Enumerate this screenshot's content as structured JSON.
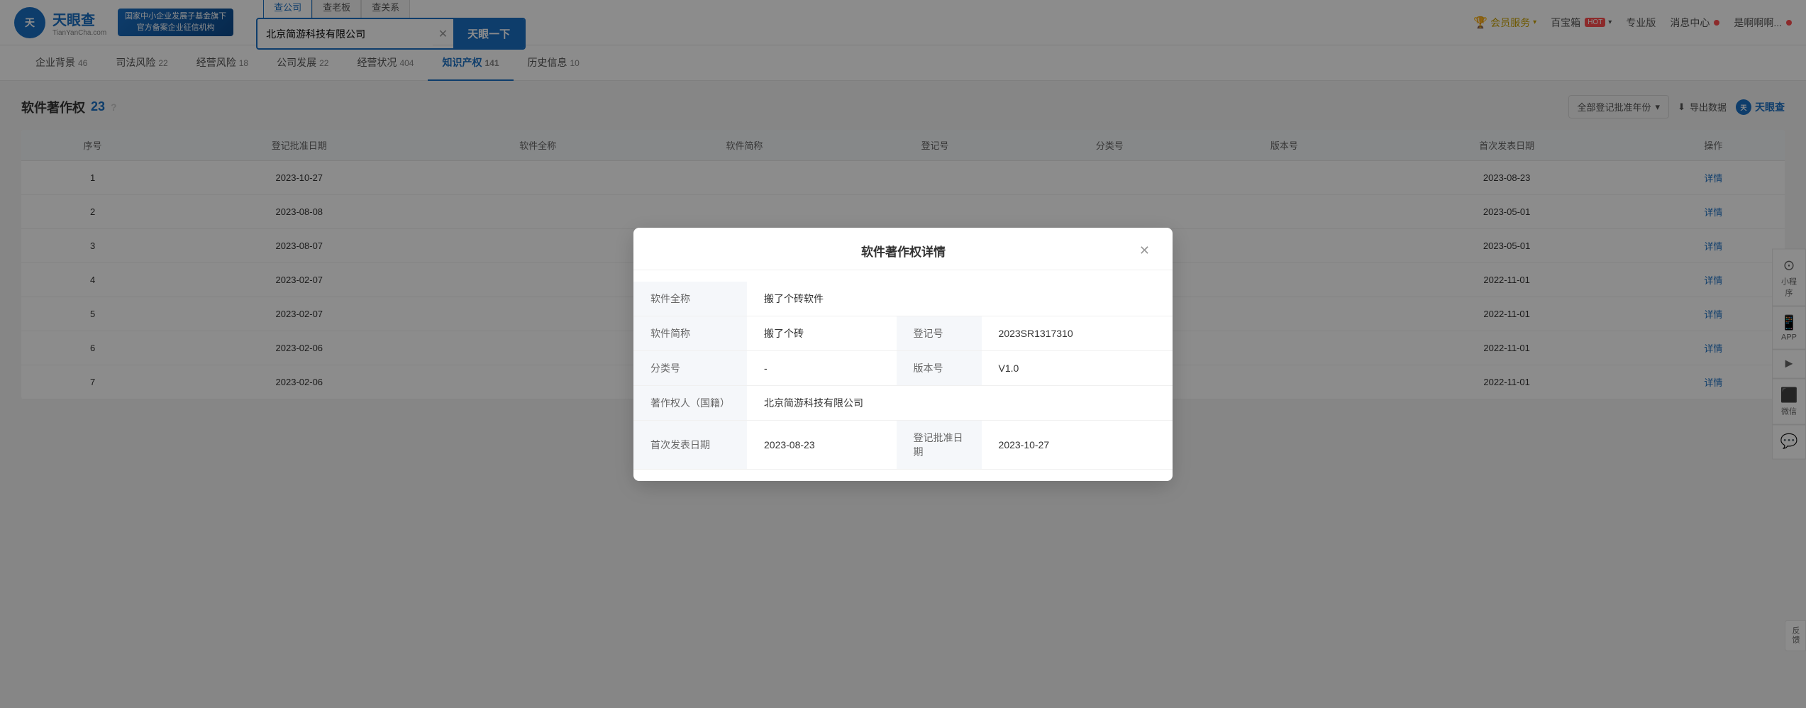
{
  "header": {
    "logo_main": "天眼查",
    "logo_sub": "TianYanCha.com",
    "gov_badge_line1": "国家中小企业发展子基金旗下",
    "gov_badge_line2": "官方备案企业征信机构",
    "search_tabs": [
      "查公司",
      "查老板",
      "查关系"
    ],
    "search_value": "北京简游科技有限公司",
    "search_btn": "天眼一下",
    "nav_items": [
      {
        "label": "会员服务",
        "type": "vip"
      },
      {
        "label": "百宝箱",
        "hot": true
      },
      {
        "label": "专业版"
      },
      {
        "label": "消息中心",
        "dot": true
      },
      {
        "label": "是啊啊啊...",
        "dot": true
      }
    ]
  },
  "sub_nav": {
    "items": [
      {
        "label": "企业背景",
        "count": "46"
      },
      {
        "label": "司法风险",
        "count": "22"
      },
      {
        "label": "经营风险",
        "count": "18"
      },
      {
        "label": "公司发展",
        "count": "22"
      },
      {
        "label": "经营状况",
        "count": "404"
      },
      {
        "label": "知识产权",
        "count": "141",
        "active": true
      },
      {
        "label": "历史信息",
        "count": "10"
      }
    ]
  },
  "section": {
    "title": "软件著作权",
    "count": "23",
    "year_filter": "全部登记批准年份",
    "export_btn": "导出数据",
    "logo_small": "天眼查"
  },
  "table": {
    "headers": [
      "序号",
      "登记批准日期",
      "软件全称",
      "软件简称",
      "登记号",
      "分类号",
      "版本号",
      "首次发表日期",
      "操作"
    ],
    "rows": [
      {
        "seq": "1",
        "date": "2023-10-27",
        "full_name": "",
        "short_name": "",
        "reg_no": "",
        "cat_no": "",
        "ver": "",
        "first_date": "2023-08-23",
        "action": "详情"
      },
      {
        "seq": "2",
        "date": "2023-08-08",
        "full_name": "",
        "short_name": "",
        "reg_no": "",
        "cat_no": "",
        "ver": "",
        "first_date": "2023-05-01",
        "action": "详情"
      },
      {
        "seq": "3",
        "date": "2023-08-07",
        "full_name": "",
        "short_name": "",
        "reg_no": "",
        "cat_no": "",
        "ver": "",
        "first_date": "2023-05-01",
        "action": "详情"
      },
      {
        "seq": "4",
        "date": "2023-02-07",
        "full_name": "",
        "short_name": "",
        "reg_no": "",
        "cat_no": "",
        "ver": "",
        "first_date": "2022-11-01",
        "action": "详情"
      },
      {
        "seq": "5",
        "date": "2023-02-07",
        "full_name": "",
        "short_name": "",
        "reg_no": "",
        "cat_no": "",
        "ver": "",
        "first_date": "2022-11-01",
        "action": "详情"
      },
      {
        "seq": "6",
        "date": "2023-02-06",
        "full_name": "",
        "short_name": "",
        "reg_no": "",
        "cat_no": "",
        "ver": "",
        "first_date": "2022-11-01",
        "action": "详情"
      },
      {
        "seq": "7",
        "date": "2023-02-06",
        "full_name": "",
        "short_name": "",
        "reg_no": "",
        "cat_no": "",
        "ver": "",
        "first_date": "2022-11-01",
        "action": "详情"
      }
    ]
  },
  "modal": {
    "title": "软件著作权详情",
    "fields": [
      {
        "label": "软件全称",
        "value": "搬了个砖软件",
        "col_span": true
      },
      {
        "label": "软件简称",
        "value": "搬了个砖",
        "label2": "登记号",
        "value2": "2023SR1317310"
      },
      {
        "label": "分类号",
        "value": "-",
        "label2": "版本号",
        "value2": "V1.0"
      },
      {
        "label": "著作权人（国籍）",
        "value": "北京简游科技有限公司",
        "col_span": true
      },
      {
        "label": "首次发表日期",
        "value": "2023-08-23",
        "label2": "登记批准日期",
        "value2": "2023-10-27"
      }
    ]
  },
  "float_btns": [
    {
      "icon": "⊙",
      "label": "小程序"
    },
    {
      "icon": "📱",
      "label": "APP"
    },
    {
      "icon": "▶",
      "label": ""
    },
    {
      "icon": "⬛",
      "label": "微信"
    },
    {
      "icon": "💬",
      "label": ""
    }
  ],
  "feedback": "反馈"
}
